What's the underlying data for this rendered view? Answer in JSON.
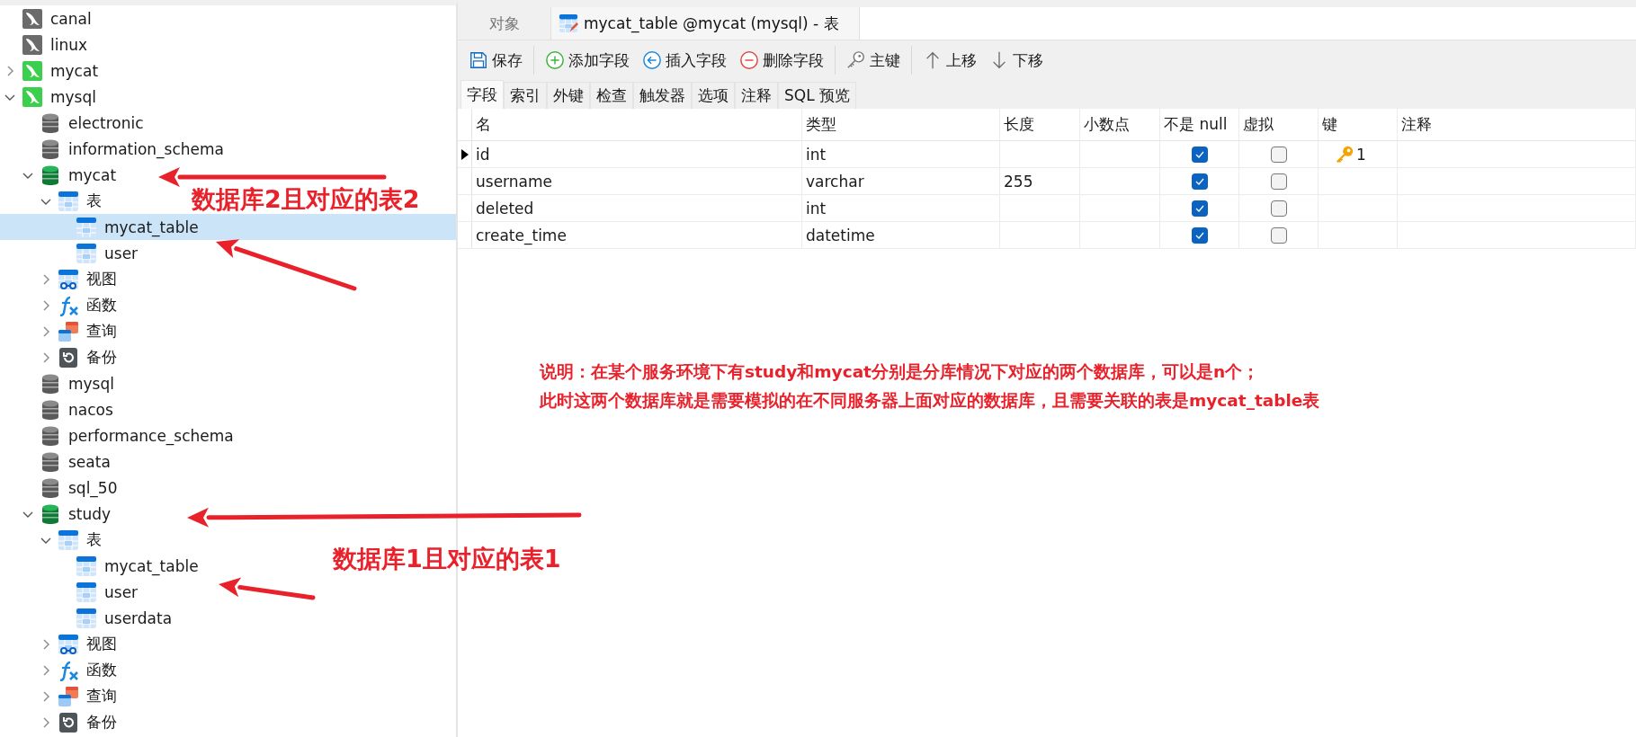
{
  "sidebar": {
    "tree": [
      {
        "label": "canal",
        "kind": "connection",
        "open": false,
        "selected": false
      },
      {
        "label": "linux",
        "kind": "connection",
        "open": false,
        "selected": false
      },
      {
        "label": "mycat",
        "kind": "connection",
        "open": true,
        "expanded": false,
        "selected": false
      },
      {
        "label": "mysql",
        "kind": "connection",
        "open": true,
        "expanded": true,
        "selected": false,
        "children": [
          {
            "label": "electronic",
            "kind": "database",
            "open": false,
            "selected": false
          },
          {
            "label": "information_schema",
            "kind": "database",
            "open": false,
            "selected": false
          },
          {
            "label": "mycat",
            "kind": "database",
            "open": true,
            "expanded": true,
            "selected": false,
            "children": [
              {
                "label": "表",
                "kind": "tables",
                "expanded": true,
                "selected": false,
                "children": [
                  {
                    "label": "mycat_table",
                    "kind": "table",
                    "selected": true
                  },
                  {
                    "label": "user",
                    "kind": "table",
                    "selected": false
                  }
                ]
              },
              {
                "label": "视图",
                "kind": "views",
                "expanded": false,
                "selected": false
              },
              {
                "label": "函数",
                "kind": "functions",
                "expanded": false,
                "selected": false
              },
              {
                "label": "查询",
                "kind": "queries",
                "expanded": false,
                "selected": false
              },
              {
                "label": "备份",
                "kind": "backups",
                "expanded": false,
                "selected": false
              }
            ]
          },
          {
            "label": "mysql",
            "kind": "database",
            "open": false,
            "selected": false
          },
          {
            "label": "nacos",
            "kind": "database",
            "open": false,
            "selected": false
          },
          {
            "label": "performance_schema",
            "kind": "database",
            "open": false,
            "selected": false
          },
          {
            "label": "seata",
            "kind": "database",
            "open": false,
            "selected": false
          },
          {
            "label": "sql_50",
            "kind": "database",
            "open": false,
            "selected": false
          },
          {
            "label": "study",
            "kind": "database",
            "open": true,
            "expanded": true,
            "selected": false,
            "children": [
              {
                "label": "表",
                "kind": "tables",
                "expanded": true,
                "selected": false,
                "children": [
                  {
                    "label": "mycat_table",
                    "kind": "table",
                    "selected": false
                  },
                  {
                    "label": "user",
                    "kind": "table",
                    "selected": false
                  },
                  {
                    "label": "userdata",
                    "kind": "table",
                    "selected": false
                  }
                ]
              },
              {
                "label": "视图",
                "kind": "views",
                "expanded": false,
                "selected": false
              },
              {
                "label": "函数",
                "kind": "functions",
                "expanded": false,
                "selected": false
              },
              {
                "label": "查询",
                "kind": "queries",
                "expanded": false,
                "selected": false
              },
              {
                "label": "备份",
                "kind": "backups",
                "expanded": false,
                "selected": false
              }
            ]
          }
        ]
      }
    ]
  },
  "tabs": [
    {
      "label": "对象",
      "kind": "plain",
      "selected": false
    },
    {
      "label": "mycat_table @mycat (mysql) - 表",
      "kind": "table",
      "selected": true
    }
  ],
  "toolbar_groups": [
    [
      {
        "kind": "save",
        "label": "保存"
      }
    ],
    [
      {
        "kind": "add",
        "label": "添加字段"
      },
      {
        "kind": "insert",
        "label": "插入字段"
      },
      {
        "kind": "delete",
        "label": "删除字段"
      }
    ],
    [
      {
        "kind": "key",
        "label": "主键"
      }
    ],
    [
      {
        "kind": "up",
        "label": "上移"
      },
      {
        "kind": "down",
        "label": "下移"
      }
    ]
  ],
  "subtabs": [
    {
      "label": "字段",
      "selected": true
    },
    {
      "label": "索引",
      "selected": false
    },
    {
      "label": "外键",
      "selected": false
    },
    {
      "label": "检查",
      "selected": false
    },
    {
      "label": "触发器",
      "selected": false
    },
    {
      "label": "选项",
      "selected": false
    },
    {
      "label": "注释",
      "selected": false
    },
    {
      "label": "SQL 预览",
      "selected": false
    }
  ],
  "table": {
    "columns": [
      "名",
      "类型",
      "长度",
      "小数点",
      "不是 null",
      "虚拟",
      "键",
      "注释"
    ],
    "rows": [
      {
        "current": true,
        "name": "id",
        "type": "int",
        "not_null": true,
        "virtual": false,
        "key": "1"
      },
      {
        "current": false,
        "name": "username",
        "type": "varchar",
        "length": "255",
        "not_null": true,
        "virtual": false
      },
      {
        "current": false,
        "name": "deleted",
        "type": "int",
        "not_null": true,
        "virtual": false
      },
      {
        "current": false,
        "name": "create_time",
        "type": "datetime",
        "not_null": true,
        "virtual": false
      }
    ]
  },
  "annotations": {
    "labels": [
      "数据库2且对应的表2",
      "数据库1且对应的表1"
    ],
    "note": [
      "说明：在某个服务环境下有study和mycat分别是分库情况下对应的两个数据库，可以是n个；",
      "此时这两个数据库就是需要模拟的在不同服务器上面对应的数据库，且需要关联的表是mycat_table表"
    ]
  }
}
